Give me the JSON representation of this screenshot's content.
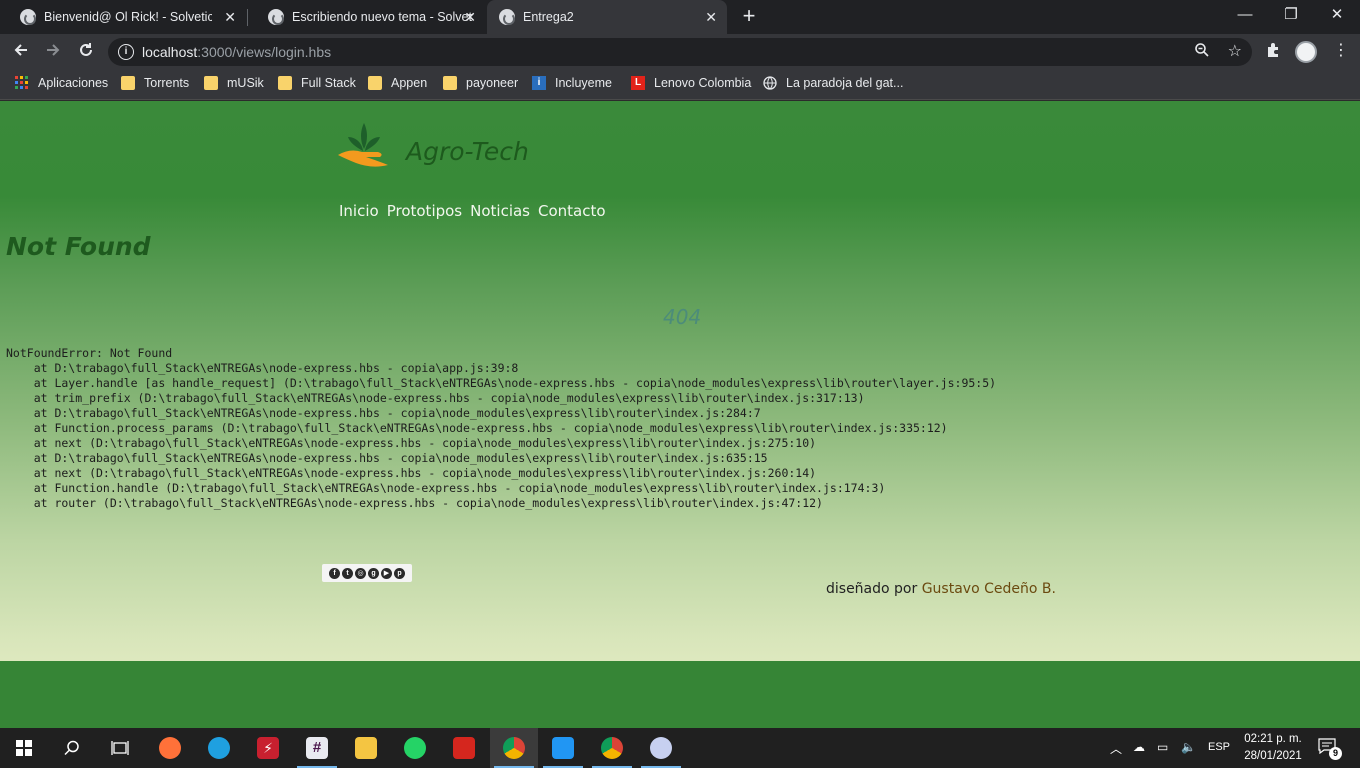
{
  "browser": {
    "tabs": [
      {
        "title": "Bienvenid@ Ol Rick! - Solvetic",
        "active": false
      },
      {
        "title": "Escribiendo nuevo tema - Solvetic",
        "active": false
      },
      {
        "title": "Entrega2",
        "active": true
      }
    ],
    "new_tab_icon": "plus-icon",
    "window_controls": {
      "minimize": "—",
      "restore": "❐",
      "close": "✕"
    },
    "url_host": "localhost",
    "url_path": ":3000/views/login.hbs",
    "bookmarks": [
      {
        "label": "Aplicaciones",
        "icon": "apps-grid-icon",
        "color": "#e8453c"
      },
      {
        "label": "Torrents",
        "icon": "folder-icon",
        "color": "#f9d36b"
      },
      {
        "label": "mUSik",
        "icon": "folder-icon",
        "color": "#f9d36b"
      },
      {
        "label": "Full Stack",
        "icon": "folder-icon",
        "color": "#f9d36b"
      },
      {
        "label": "Appen",
        "icon": "folder-icon",
        "color": "#f9d36b"
      },
      {
        "label": "payoneer",
        "icon": "folder-icon",
        "color": "#f9d36b"
      },
      {
        "label": "Incluyeme",
        "icon": "incluyeme-icon",
        "color": "#2a6ebd"
      },
      {
        "label": "Lenovo Colombia",
        "icon": "lenovo-icon",
        "color": "#e2231a"
      },
      {
        "label": "La paradoja del gat...",
        "icon": "globe-icon",
        "color": "#e8eaed"
      }
    ]
  },
  "page": {
    "brand": "Agro-Tech",
    "nav": [
      "Inicio",
      "Prototipos",
      "Noticias",
      "Contacto"
    ],
    "error_title": "Not Found",
    "error_status": "404",
    "stack_trace": "NotFoundError: Not Found\n    at D:\\trabago\\full_Stack\\eNTREGAs\\node-express.hbs - copia\\app.js:39:8\n    at Layer.handle [as handle_request] (D:\\trabago\\full_Stack\\eNTREGAs\\node-express.hbs - copia\\node_modules\\express\\lib\\router\\layer.js:95:5)\n    at trim_prefix (D:\\trabago\\full_Stack\\eNTREGAs\\node-express.hbs - copia\\node_modules\\express\\lib\\router\\index.js:317:13)\n    at D:\\trabago\\full_Stack\\eNTREGAs\\node-express.hbs - copia\\node_modules\\express\\lib\\router\\index.js:284:7\n    at Function.process_params (D:\\trabago\\full_Stack\\eNTREGAs\\node-express.hbs - copia\\node_modules\\express\\lib\\router\\index.js:335:12)\n    at next (D:\\trabago\\full_Stack\\eNTREGAs\\node-express.hbs - copia\\node_modules\\express\\lib\\router\\index.js:275:10)\n    at D:\\trabago\\full_Stack\\eNTREGAs\\node-express.hbs - copia\\node_modules\\express\\lib\\router\\index.js:635:15\n    at next (D:\\trabago\\full_Stack\\eNTREGAs\\node-express.hbs - copia\\node_modules\\express\\lib\\router\\index.js:260:14)\n    at Function.handle (D:\\trabago\\full_Stack\\eNTREGAs\\node-express.hbs - copia\\node_modules\\express\\lib\\router\\index.js:174:3)\n    at router (D:\\trabago\\full_Stack\\eNTREGAs\\node-express.hbs - copia\\node_modules\\express\\lib\\router\\index.js:47:12)",
    "social_icons": [
      "facebook-icon",
      "twitter-icon",
      "instagram-icon",
      "googleplus-icon",
      "youtube-icon",
      "pinterest-icon"
    ],
    "credit_prefix": "diseñado por",
    "credit_author": "Gustavo Cedeño B.",
    "colors": {
      "header_green": "#388a38",
      "brand_text": "#1d5a1d",
      "status_text": "#4c8c7a",
      "author_text": "#6b4a10"
    }
  },
  "taskbar": {
    "apps": [
      {
        "name": "firefox",
        "icon": "firefox-icon",
        "color": "#ff7139",
        "running": false,
        "active": false
      },
      {
        "name": "edge",
        "icon": "edge-icon",
        "color": "#1fa0e0",
        "running": false,
        "active": false
      },
      {
        "name": "flash-app",
        "icon": "lightning-icon",
        "color": "#c8202f",
        "running": false,
        "active": false
      },
      {
        "name": "slack",
        "icon": "slack-icon",
        "color": "#e9eaf0",
        "running": true,
        "active": false
      },
      {
        "name": "file-explorer",
        "icon": "folder-icon",
        "color": "#f4c542",
        "running": false,
        "active": false
      },
      {
        "name": "whatsapp",
        "icon": "whatsapp-icon",
        "color": "#25d366",
        "running": false,
        "active": false
      },
      {
        "name": "acrobat",
        "icon": "acrobat-icon",
        "color": "#d5261e",
        "running": false,
        "active": false
      },
      {
        "name": "chrome",
        "icon": "chrome-icon",
        "color": "#4caf50",
        "running": true,
        "active": true
      },
      {
        "name": "vscode",
        "icon": "vscode-icon",
        "color": "#2196f3",
        "running": true,
        "active": false
      },
      {
        "name": "chrome-profile",
        "icon": "chrome-icon",
        "color": "#db4437",
        "running": true,
        "active": false
      },
      {
        "name": "paint",
        "icon": "paint-icon",
        "color": "#c7d0f0",
        "running": true,
        "active": false
      }
    ],
    "tray_language": "ESP",
    "time": "02:21 p. m.",
    "date": "28/01/2021",
    "notification_count": "9"
  }
}
